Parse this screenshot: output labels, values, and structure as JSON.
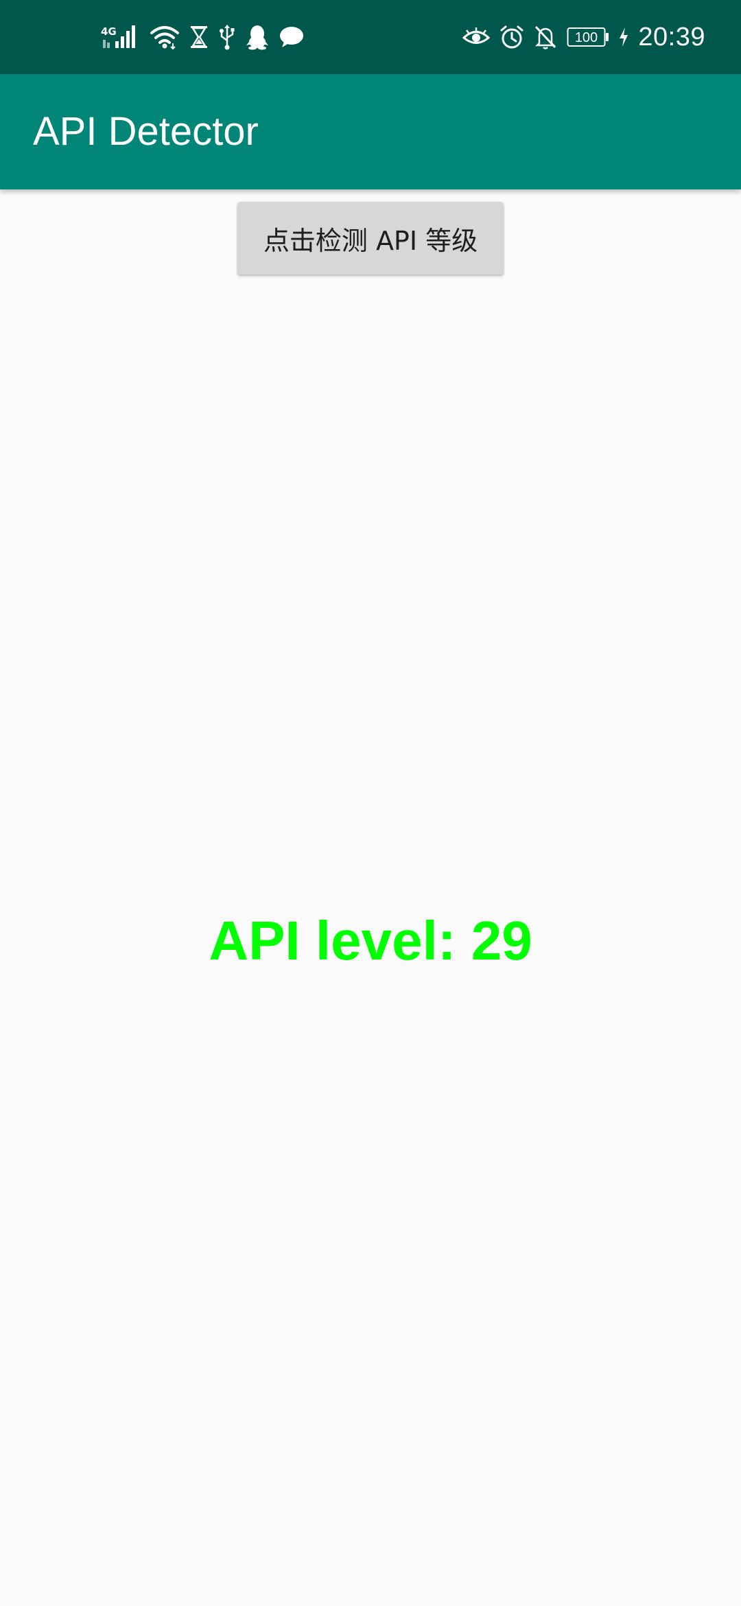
{
  "status_bar": {
    "network_label": "4G",
    "battery_level": "100",
    "time": "20:39",
    "background_color": "#00574B",
    "left_icons": [
      "network-4g-icon",
      "signal-icon",
      "wifi-icon",
      "hourglass-icon",
      "usb-icon",
      "qq-icon",
      "chat-bubble-icon"
    ],
    "right_icons": [
      "eye-icon",
      "alarm-icon",
      "notifications-off-icon",
      "battery-icon",
      "charging-icon"
    ]
  },
  "app_bar": {
    "title": "API Detector",
    "background_color": "#008577"
  },
  "main": {
    "detect_button_label": "点击检测 API 等级",
    "api_level_text": "API level: 29",
    "api_level_color": "#00FF00",
    "background_color": "#FAFAFA"
  }
}
